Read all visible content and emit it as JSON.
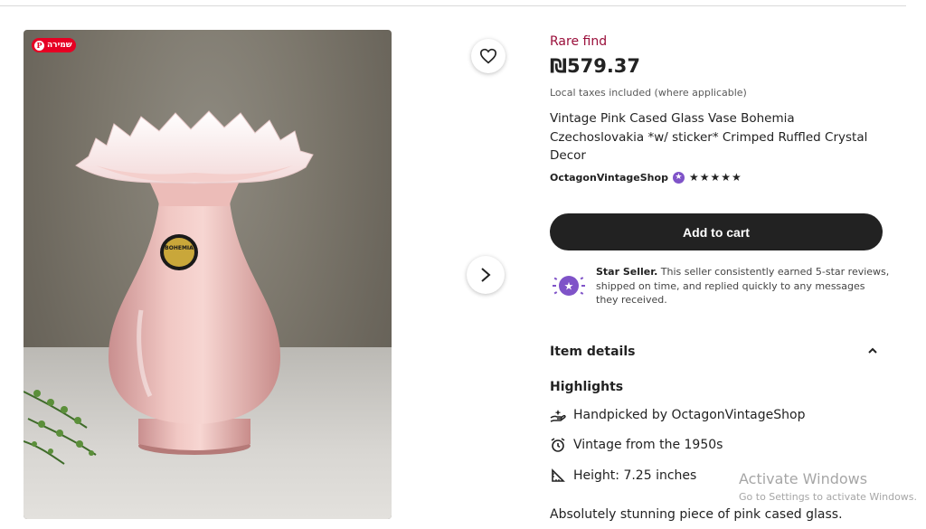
{
  "pin_badge": {
    "label": "שמירה"
  },
  "product": {
    "rare_label": "Rare find",
    "price": "₪579.37",
    "taxes_note": "Local taxes included (where applicable)",
    "title": "Vintage Pink Cased Glass Vase Bohemia Czechoslovakia *w/ sticker* Crimped Ruffled Crystal Decor",
    "shop_name": "OctagonVintageShop",
    "rating_stars": "★★★★★",
    "add_to_cart": "Add to cart"
  },
  "star_seller": {
    "title": "Star Seller.",
    "body": " This seller consistently earned 5-star reviews, shipped on time, and replied quickly to any messages they received."
  },
  "item_details": {
    "heading": "Item details",
    "highlights_heading": "Highlights",
    "highlights": [
      {
        "icon": "hand-picked-icon",
        "prefix": "Handpicked by ",
        "strong": "OctagonVintageShop"
      },
      {
        "icon": "clock-icon",
        "text": "Vintage from the 1950s"
      },
      {
        "icon": "ruler-icon",
        "text": "Height: 7.25 inches"
      }
    ],
    "description": "Absolutely stunning piece of pink cased glass."
  },
  "watermark": {
    "line1": "Activate Windows",
    "line2": "Go to Settings to activate Windows."
  },
  "colors": {
    "accent_dark": "#222222",
    "rare_find": "#9a0e3a",
    "star_seller_purple": "#7f53c8",
    "pinterest_red": "#e60023"
  }
}
